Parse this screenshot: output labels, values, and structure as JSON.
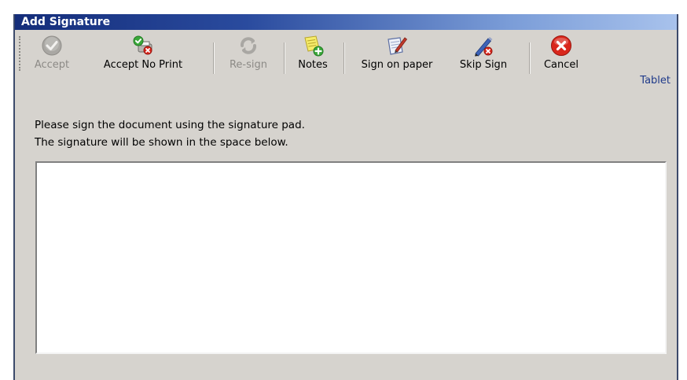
{
  "window": {
    "title": "Add Signature"
  },
  "toolbar": {
    "buttons": [
      {
        "label": "Accept",
        "icon": "check-circle-icon",
        "enabled": false
      },
      {
        "label": "Accept No Print",
        "icon": "accept-no-print-icon",
        "enabled": true
      },
      {
        "label": "Re-sign",
        "icon": "refresh-icon",
        "enabled": false
      },
      {
        "label": "Notes",
        "icon": "notes-add-icon",
        "enabled": true
      },
      {
        "label": "Sign on paper",
        "icon": "sign-paper-icon",
        "enabled": true
      },
      {
        "label": "Skip Sign",
        "icon": "pen-skip-icon",
        "enabled": true
      },
      {
        "label": "Cancel",
        "icon": "cancel-icon",
        "enabled": true
      }
    ],
    "tablet_label": "Tablet"
  },
  "instructions": {
    "line1": "Please sign the document using the signature pad.",
    "line2": "The signature will be shown in the space below."
  },
  "colors": {
    "title_bar": "#142d7a",
    "dialog_bg": "#d6d3ce",
    "cancel_red": "#d9271c",
    "check_green": "#3aa83a"
  }
}
